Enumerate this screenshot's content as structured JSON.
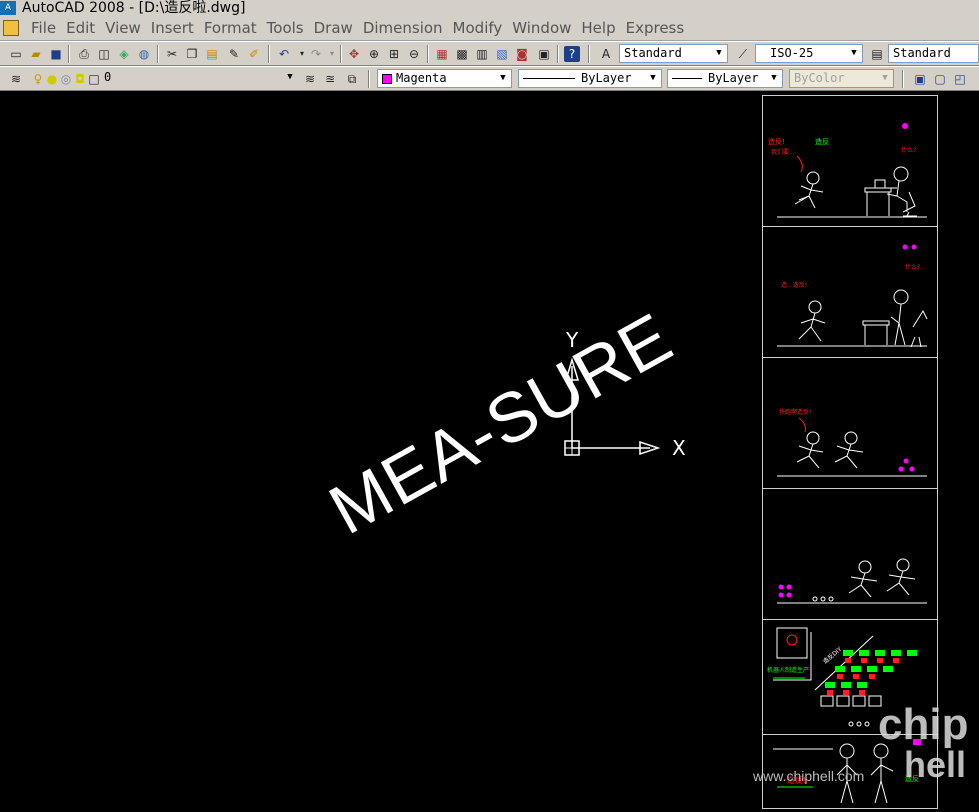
{
  "window": {
    "title": "AutoCAD 2008 - [D:\\造反啦.dwg]"
  },
  "menu": [
    "File",
    "Edit",
    "View",
    "Insert",
    "Format",
    "Tools",
    "Draw",
    "Dimension",
    "Modify",
    "Window",
    "Help",
    "Express"
  ],
  "toolbar1": {
    "text_style": "Standard",
    "dim_style": "ISO-25",
    "table_style": "Standard"
  },
  "toolbar2": {
    "layer": "0",
    "color": "Magenta",
    "linetype": "ByLayer",
    "lineweight": "ByLayer",
    "plot_style": "ByColor"
  },
  "colors": {
    "accent_magenta": "#ff00ff",
    "canvas": "#000000",
    "chrome": "#d4d0c8",
    "green": "#00ff00",
    "red": "#ff2020"
  },
  "ucs": {
    "x_label": "X",
    "y_label": "Y"
  },
  "watermark": {
    "text": "MEA-SURE",
    "site": "www.chiphell.com",
    "logo_top": "chip",
    "logo_bottom": "hell"
  },
  "panels": [
    {
      "caption": "造反!",
      "icon": "stick-figure-comic-panel"
    },
    {
      "caption": "",
      "icon": "stick-figure-comic-panel"
    },
    {
      "caption": "",
      "icon": "stick-figure-comic-panel"
    },
    {
      "caption": "",
      "icon": "stick-figure-comic-panel"
    },
    {
      "caption": "",
      "icon": "stick-figure-comic-panel"
    },
    {
      "caption": "",
      "icon": "stick-figure-comic-panel"
    }
  ]
}
